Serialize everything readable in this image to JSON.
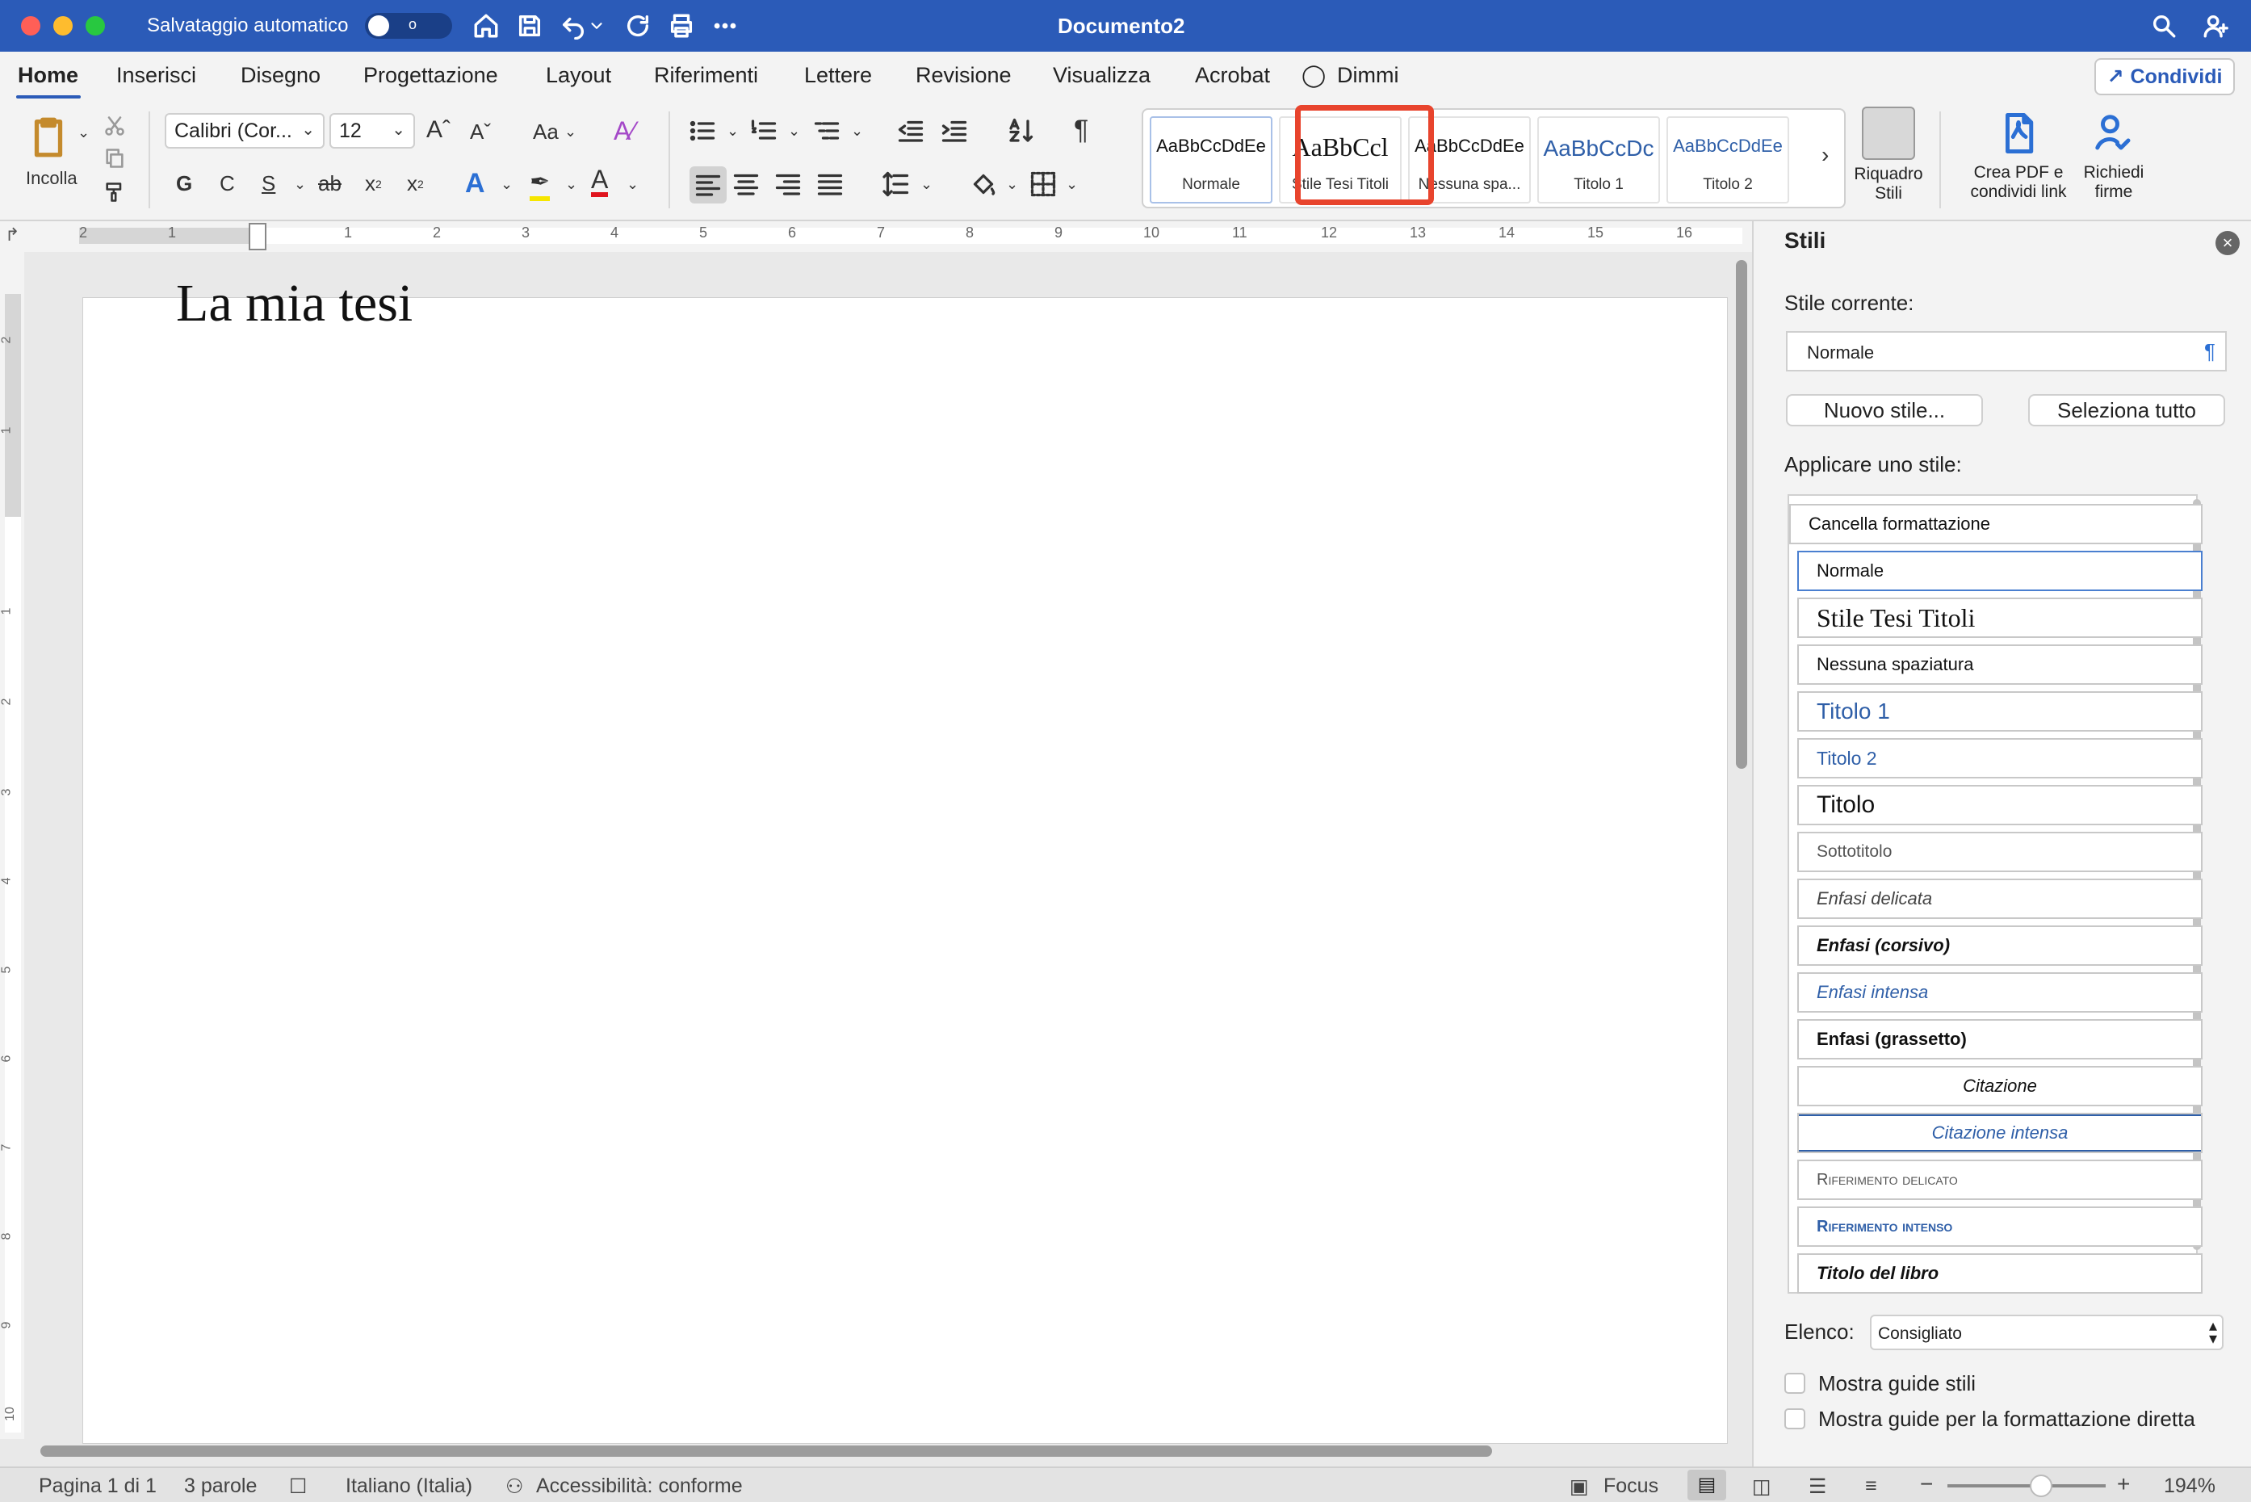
{
  "titlebar": {
    "autosave_label": "Salvataggio automatico",
    "autosave_state": "o",
    "doc_title": "Documento2"
  },
  "tabs": [
    {
      "label": "Home"
    },
    {
      "label": "Inserisci"
    },
    {
      "label": "Disegno"
    },
    {
      "label": "Progettazione"
    },
    {
      "label": "Layout"
    },
    {
      "label": "Riferimenti"
    },
    {
      "label": "Lettere"
    },
    {
      "label": "Revisione"
    },
    {
      "label": "Visualizza"
    },
    {
      "label": "Acrobat"
    },
    {
      "label": "Dimmi"
    }
  ],
  "share_label": "Condividi",
  "ribbon": {
    "paste_label": "Incolla",
    "font_name": "Calibri (Cor...",
    "font_size": "12",
    "case_label": "Aa",
    "bold": "G",
    "italic": "C",
    "underline": "S",
    "strike": "ab",
    "subscript": "x",
    "superscript": "x",
    "text_effect": "A",
    "font_color": "A",
    "styles_gallery": [
      {
        "preview": "AaBbCcDdEe",
        "label": "Normale"
      },
      {
        "preview": "AaBbCcl",
        "label": "Stile Tesi Titoli"
      },
      {
        "preview": "AaBbCcDdEe",
        "label": "Nessuna spa..."
      },
      {
        "preview": "AaBbCcDc",
        "label": "Titolo 1"
      },
      {
        "preview": "AaBbCcDdEe",
        "label": "Titolo 2"
      }
    ],
    "styles_pane_btn": "Riquadro Stili",
    "pdf_btn": "Crea PDF e condividi link",
    "sign_btn": "Richiedi firme"
  },
  "ruler_numbers": [
    "2",
    "1",
    "1",
    "2",
    "3",
    "4",
    "5",
    "6",
    "7",
    "8",
    "9",
    "10",
    "11",
    "12",
    "13",
    "14",
    "15",
    "16"
  ],
  "vruler_numbers": [
    "2",
    "1",
    "1",
    "2",
    "3",
    "4",
    "5",
    "6",
    "7",
    "8",
    "9",
    "10"
  ],
  "document": {
    "title_text": "La mia tesi"
  },
  "styles_pane": {
    "title": "Stili",
    "current_style_label": "Stile corrente:",
    "current_style_value": "Normale",
    "new_style_btn": "Nuovo stile...",
    "select_all_btn": "Seleziona tutto",
    "apply_label": "Applicare uno stile:",
    "styles": [
      "Cancella formattazione",
      "Normale",
      "Stile Tesi Titoli",
      "Nessuna spaziatura",
      "Titolo 1",
      "Titolo 2",
      "Titolo",
      "Sottotitolo",
      "Enfasi delicata",
      "Enfasi (corsivo)",
      "Enfasi intensa",
      "Enfasi (grassetto)",
      "Citazione",
      "Citazione intensa",
      "Riferimento delicato",
      "Riferimento intenso",
      "Titolo del libro"
    ],
    "list_label": "Elenco:",
    "list_value": "Consigliato",
    "check1": "Mostra guide stili",
    "check2": "Mostra guide per la formattazione diretta"
  },
  "status": {
    "page": "Pagina 1 di 1",
    "words": "3 parole",
    "language": "Italiano (Italia)",
    "accessibility": "Accessibilità: conforme",
    "focus": "Focus",
    "zoom": "194%"
  },
  "colors": {
    "titlebar": "#2b5bb8",
    "highlight": "#e8442d",
    "heading_blue": "#2f5fa8"
  }
}
